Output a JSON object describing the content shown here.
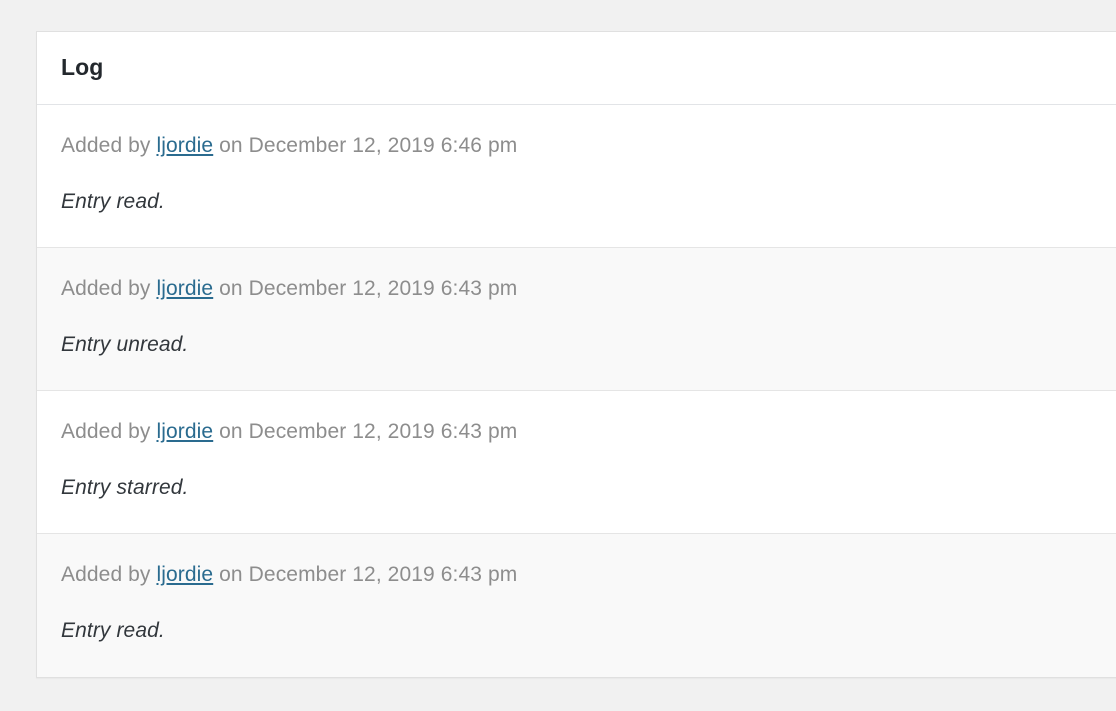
{
  "page": {
    "background_color": "#f1f1f1"
  },
  "card": {
    "title": "Log",
    "background_color": "#ffffff",
    "border_color": "#e0e0e0",
    "alt_row_color": "#f9f9f9",
    "link_color": "#2a6b8f",
    "meta_color": "#8d8d8d",
    "text_color": "#32373c"
  },
  "log": {
    "entries": [
      {
        "prefix": "Added by",
        "author": "ljordie",
        "connector": "on",
        "timestamp": "December 12, 2019 6:46 pm",
        "message": "Entry read."
      },
      {
        "prefix": "Added by",
        "author": "ljordie",
        "connector": "on",
        "timestamp": "December 12, 2019 6:43 pm",
        "message": "Entry unread."
      },
      {
        "prefix": "Added by",
        "author": "ljordie",
        "connector": "on",
        "timestamp": "December 12, 2019 6:43 pm",
        "message": "Entry starred."
      },
      {
        "prefix": "Added by",
        "author": "ljordie",
        "connector": "on",
        "timestamp": "December 12, 2019 6:43 pm",
        "message": "Entry read."
      }
    ]
  }
}
